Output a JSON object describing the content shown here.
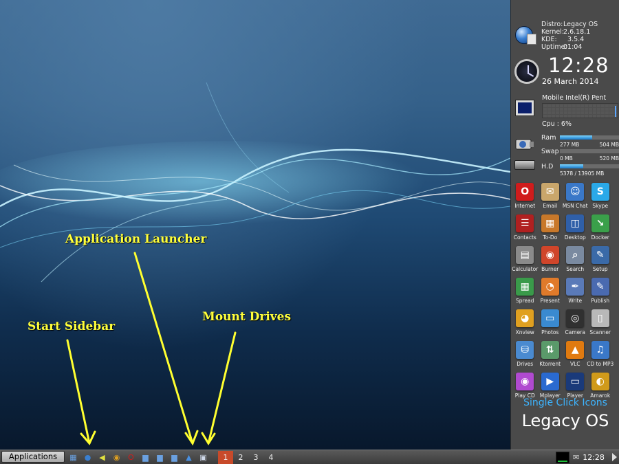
{
  "annotations": {
    "app_launcher": "Application Launcher",
    "start_sidebar": "Start Sidebar",
    "mount_drives": "Mount Drives"
  },
  "sysinfo": {
    "distro_key": "Distro:",
    "distro_val": "Legacy OS",
    "kernel_key": "Kernel:",
    "kernel_val": "2.6.18.1",
    "kde_key": "KDE:",
    "kde_val": "3.5.4",
    "uptime_key": "Uptime:",
    "uptime_val": "01:04"
  },
  "clock": {
    "time": "12:28",
    "date": "26 March 2014"
  },
  "cpu": {
    "name": "Mobile Intel(R) Pent",
    "load_text": "Cpu : 6%"
  },
  "memory": {
    "ram": {
      "label": "Ram",
      "used": "277 MB",
      "total": "504 MB",
      "fraction": 0.55
    },
    "swap": {
      "label": "Swap",
      "used": "0 MB",
      "total": "520 MB",
      "fraction": 0.0
    },
    "hd": {
      "label": "H.D",
      "used": "5378 / 13905 MB",
      "total": "",
      "fraction": 0.39
    }
  },
  "apps": [
    {
      "label": "Internet",
      "icon": "opera-icon",
      "glyph": "O",
      "color": "#d01c1c"
    },
    {
      "label": "Email",
      "icon": "email-icon",
      "glyph": "✉",
      "color": "#c9a66b"
    },
    {
      "label": "MSN Chat",
      "icon": "msn-icon",
      "glyph": "☺",
      "color": "#3a78c8"
    },
    {
      "label": "Skype",
      "icon": "skype-icon",
      "glyph": "S",
      "color": "#2aa9e8"
    },
    {
      "label": "Contacts",
      "icon": "contacts-icon",
      "glyph": "☰",
      "color": "#b02020"
    },
    {
      "label": "To-Do",
      "icon": "todo-icon",
      "glyph": "▦",
      "color": "#c8782a"
    },
    {
      "label": "Desktop",
      "icon": "desktop-icon",
      "glyph": "◫",
      "color": "#2f5fa8"
    },
    {
      "label": "Docker",
      "icon": "docker-icon",
      "glyph": "↘",
      "color": "#3aa04a"
    },
    {
      "label": "Calculator",
      "icon": "calculator-icon",
      "glyph": "▤",
      "color": "#8a8a8a"
    },
    {
      "label": "Burner",
      "icon": "burner-icon",
      "glyph": "◉",
      "color": "#d0452a"
    },
    {
      "label": "Search",
      "icon": "search-icon",
      "glyph": "⌕",
      "color": "#7a8aa0"
    },
    {
      "label": "Setup",
      "icon": "setup-icon",
      "glyph": "✎",
      "color": "#3a6aa8"
    },
    {
      "label": "Spread",
      "icon": "spreadsheet-icon",
      "glyph": "▦",
      "color": "#3a9a4a"
    },
    {
      "label": "Present",
      "icon": "presentation-icon",
      "glyph": "◔",
      "color": "#e07a2a"
    },
    {
      "label": "Write",
      "icon": "write-icon",
      "glyph": "✒",
      "color": "#5a7ab8"
    },
    {
      "label": "Publish",
      "icon": "publish-icon",
      "glyph": "✎",
      "color": "#4a6ab0"
    },
    {
      "label": "Xnview",
      "icon": "xnview-icon",
      "glyph": "◕",
      "color": "#e0a020"
    },
    {
      "label": "Photos",
      "icon": "photos-icon",
      "glyph": "▭",
      "color": "#3a8ad0"
    },
    {
      "label": "Camera",
      "icon": "camera-icon",
      "glyph": "◎",
      "color": "#303030"
    },
    {
      "label": "Scanner",
      "icon": "scanner-icon",
      "glyph": "▯",
      "color": "#b8b8b8"
    },
    {
      "label": "Drives",
      "icon": "drives-icon",
      "glyph": "⛁",
      "color": "#4a8ad0"
    },
    {
      "label": "Ktorrent",
      "icon": "ktorrent-icon",
      "glyph": "⇅",
      "color": "#5a9a6a"
    },
    {
      "label": "VLC",
      "icon": "vlc-icon",
      "glyph": "▲",
      "color": "#e07a10"
    },
    {
      "label": "CD to MP3",
      "icon": "cd-to-mp3-icon",
      "glyph": "♫",
      "color": "#3a78c8"
    },
    {
      "label": "Play CD",
      "icon": "play-cd-icon",
      "glyph": "◉",
      "color": "#b04ad0"
    },
    {
      "label": "Mplayer",
      "icon": "mplayer-icon",
      "glyph": "▶",
      "color": "#2a6ad0"
    },
    {
      "label": "Player",
      "icon": "player-icon",
      "glyph": "▭",
      "color": "#1a3a7a"
    },
    {
      "label": "Amarok",
      "icon": "amarok-icon",
      "glyph": "◐",
      "color": "#d09a1a"
    }
  ],
  "sidebar_footer": {
    "tagline": "Single Click Icons",
    "brand": "Legacy OS"
  },
  "taskbar": {
    "start_label": "Applications",
    "tray_icons": [
      {
        "name": "start-sidebar-icon",
        "glyph": "▦",
        "color": "#6aa0e0"
      },
      {
        "name": "application-launcher-globe-icon",
        "glyph": "●",
        "color": "#3a7fd0"
      },
      {
        "name": "volume-icon",
        "glyph": "◀",
        "color": "#e0e040"
      },
      {
        "name": "kde-icon",
        "glyph": "◉",
        "color": "#e0a020"
      },
      {
        "name": "opera-icon",
        "glyph": "O",
        "color": "#d01c1c"
      },
      {
        "name": "folder-icon",
        "glyph": "▆",
        "color": "#6aa0e0"
      },
      {
        "name": "network-icon",
        "glyph": "▆",
        "color": "#6aa0e0"
      },
      {
        "name": "home-folder-icon",
        "glyph": "▆",
        "color": "#6aa0e0"
      },
      {
        "name": "application-launcher-icon",
        "glyph": "▲",
        "color": "#4a90e0"
      },
      {
        "name": "mount-drives-icon",
        "glyph": "▣",
        "color": "#cfd8e8"
      }
    ],
    "pages": [
      "1",
      "2",
      "3",
      "4"
    ],
    "active_page": "1",
    "clock": "12:28"
  }
}
